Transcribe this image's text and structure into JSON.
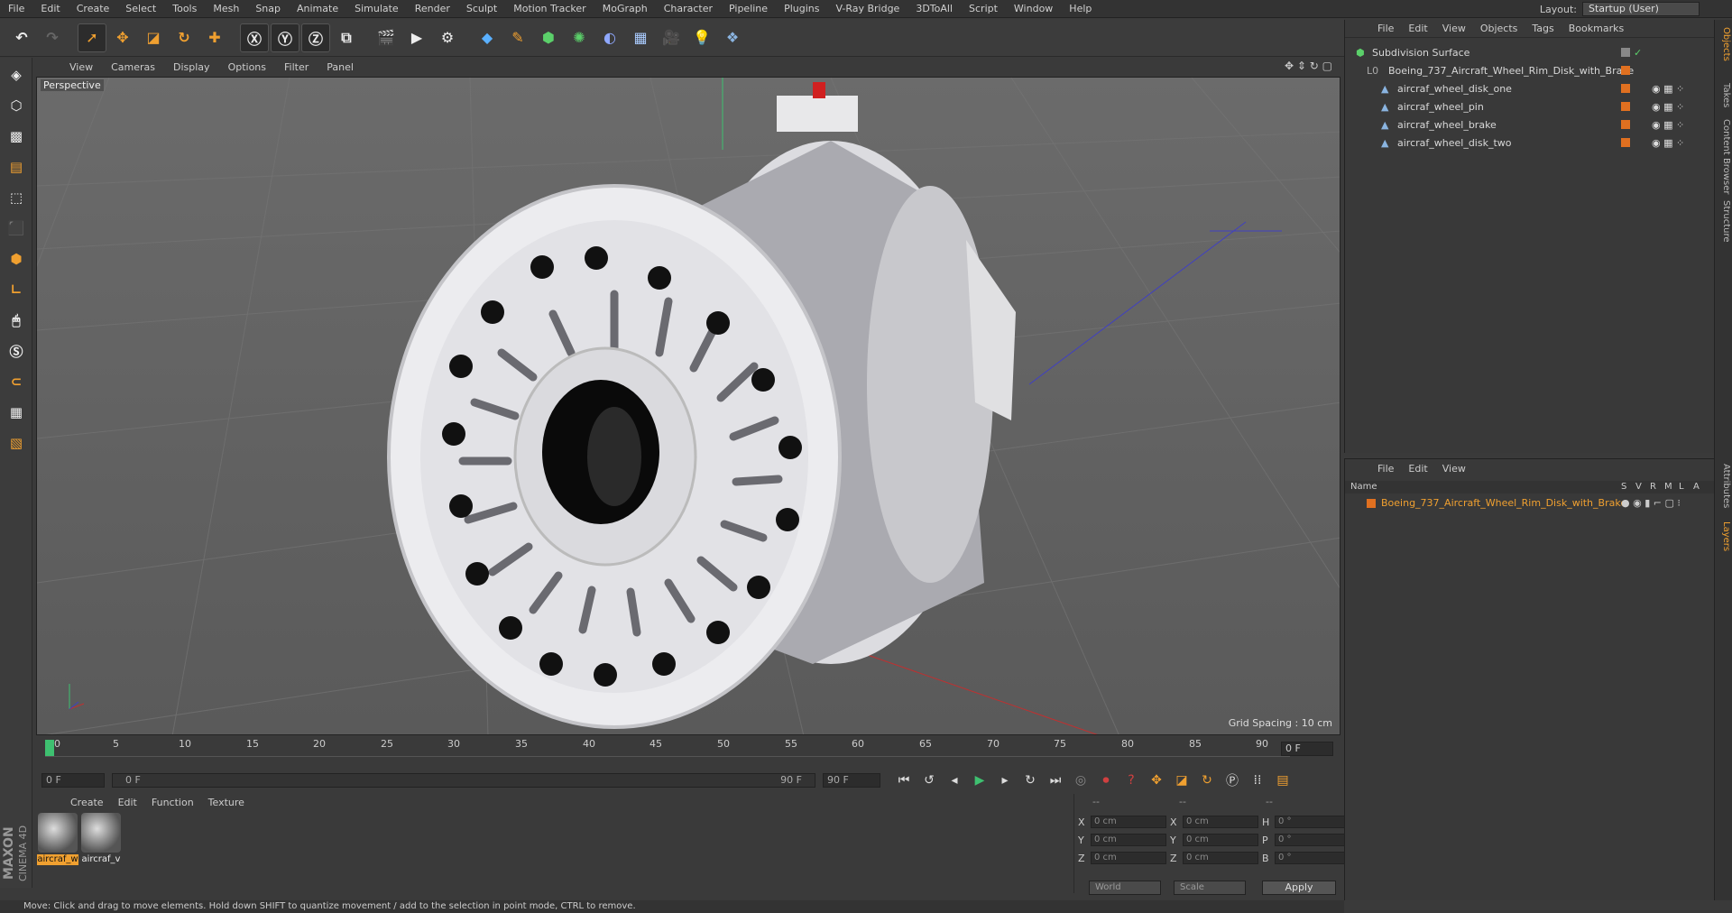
{
  "menubar": [
    "File",
    "Edit",
    "Create",
    "Select",
    "Tools",
    "Mesh",
    "Snap",
    "Animate",
    "Simulate",
    "Render",
    "Sculpt",
    "Motion Tracker",
    "MoGraph",
    "Character",
    "Pipeline",
    "Plugins",
    "V-Ray Bridge",
    "3DToAll",
    "Script",
    "Window",
    "Help"
  ],
  "layout": {
    "label": "Layout:",
    "value": "Startup (User)"
  },
  "viewport": {
    "menu": [
      "View",
      "Cameras",
      "Display",
      "Options",
      "Filter",
      "Panel"
    ],
    "label": "Perspective",
    "grid_spacing": "Grid Spacing : 10 cm"
  },
  "timeline": {
    "ticks": [
      "0",
      "5",
      "10",
      "15",
      "20",
      "25",
      "30",
      "35",
      "40",
      "45",
      "50",
      "55",
      "60",
      "65",
      "70",
      "75",
      "80",
      "85",
      "90"
    ],
    "current_frame": "0 F",
    "start": "0 F",
    "range_start": "0 F",
    "range_end": "90 F",
    "end": "90 F"
  },
  "materials": {
    "menu": [
      "Create",
      "Edit",
      "Function",
      "Texture"
    ],
    "items": [
      {
        "name": "aircraf_w",
        "selected": true
      },
      {
        "name": "aircraf_v",
        "selected": false
      }
    ]
  },
  "coords": {
    "header_left": "--",
    "header_mid": "--",
    "header_right": "--",
    "pos": {
      "x": "0 cm",
      "y": "0 cm",
      "z": "0 cm"
    },
    "size": {
      "x": "0 cm",
      "y": "0 cm",
      "z": "0 cm"
    },
    "rot": {
      "h": "0 °",
      "p": "0 °",
      "b": "0 °"
    },
    "mode_world": "World",
    "mode_scale": "Scale",
    "apply": "Apply"
  },
  "status": "Move: Click and drag to move elements. Hold down SHIFT to quantize movement / add to the selection in point mode, CTRL to remove.",
  "object_manager": {
    "menu": [
      "File",
      "Edit",
      "View",
      "Objects",
      "Tags",
      "Bookmarks"
    ],
    "rows": [
      {
        "name": "Subdivision Surface",
        "indent": 0
      },
      {
        "name": "Boeing_737_Aircraft_Wheel_Rim_Disk_with_Brake",
        "indent": 1
      },
      {
        "name": "aircraf_wheel_disk_one",
        "indent": 2
      },
      {
        "name": "aircraf_wheel_pin",
        "indent": 2
      },
      {
        "name": "aircraf_wheel_brake",
        "indent": 2
      },
      {
        "name": "aircraf_wheel_disk_two",
        "indent": 2
      }
    ]
  },
  "layer_manager": {
    "menu": [
      "File",
      "Edit",
      "View"
    ],
    "columns": [
      "Name",
      "S",
      "V",
      "R",
      "M",
      "L",
      "A"
    ],
    "layer": "Boeing_737_Aircraft_Wheel_Rim_Disk_with_Brake"
  },
  "right_tabs": [
    "Objects",
    "Takes",
    "Content Browser",
    "Structure",
    "Attributes",
    "Layers"
  ],
  "logo": [
    "MAXON",
    "CINEMA 4D"
  ],
  "colors": {
    "accent": "#f0a030",
    "layer_orange": "#e07020",
    "playhead": "#3ec070"
  }
}
